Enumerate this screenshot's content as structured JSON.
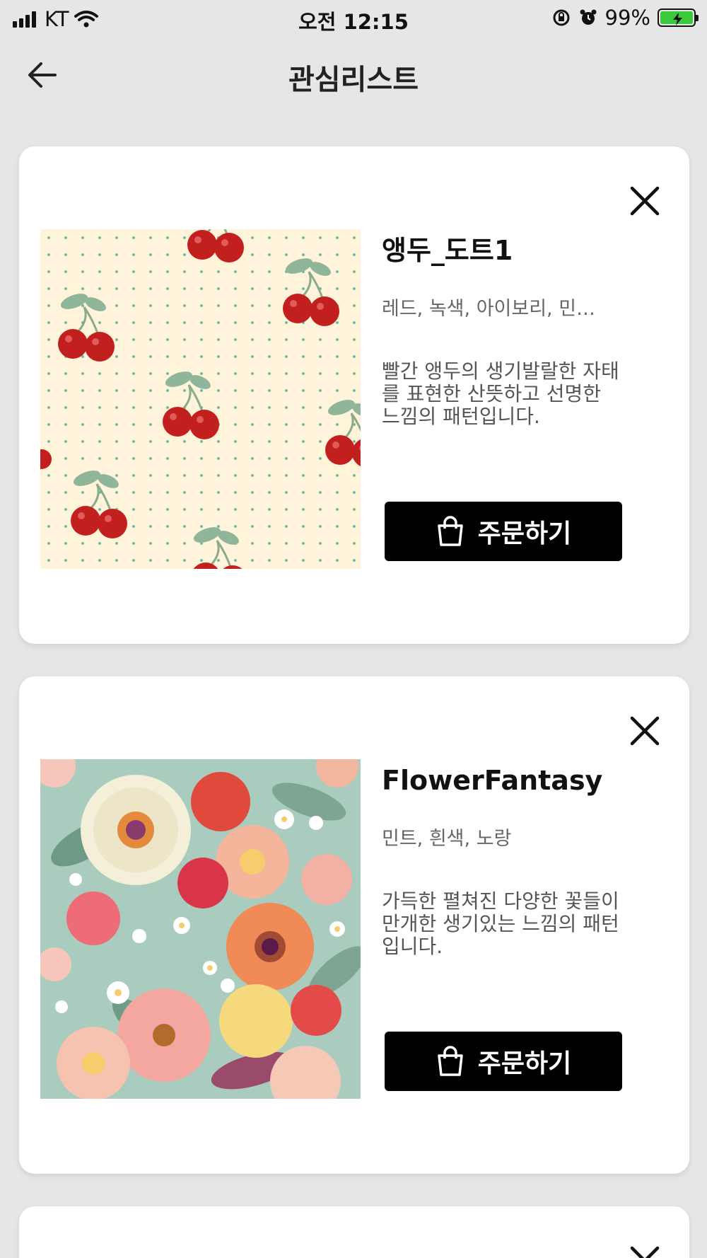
{
  "status_bar": {
    "carrier": "KT",
    "time": "오전 12:15",
    "battery_percent": "99%",
    "battery_color": "#39c93a"
  },
  "header": {
    "back_icon": "arrow-left-icon",
    "title": "관심리스트"
  },
  "items": [
    {
      "title": "앵두_도트1",
      "colors": "레드, 녹색, 아이보리, 민…",
      "description": "빨간 앵두의 생기발랄한 자태를 표현한 산뜻하고 선명한 느낌의 패턴입니다.",
      "order_label": "주문하기",
      "order_icon": "shopping-bag-icon",
      "close_icon": "close-icon"
    },
    {
      "title": "FlowerFantasy",
      "colors": "민트, 흰색, 노랑",
      "description": "가득한 펼쳐진 다양한 꽃들이 만개한 생기있는 느낌의 패턴입니다.",
      "order_label": "주문하기",
      "order_icon": "shopping-bag-icon",
      "close_icon": "close-icon"
    }
  ]
}
